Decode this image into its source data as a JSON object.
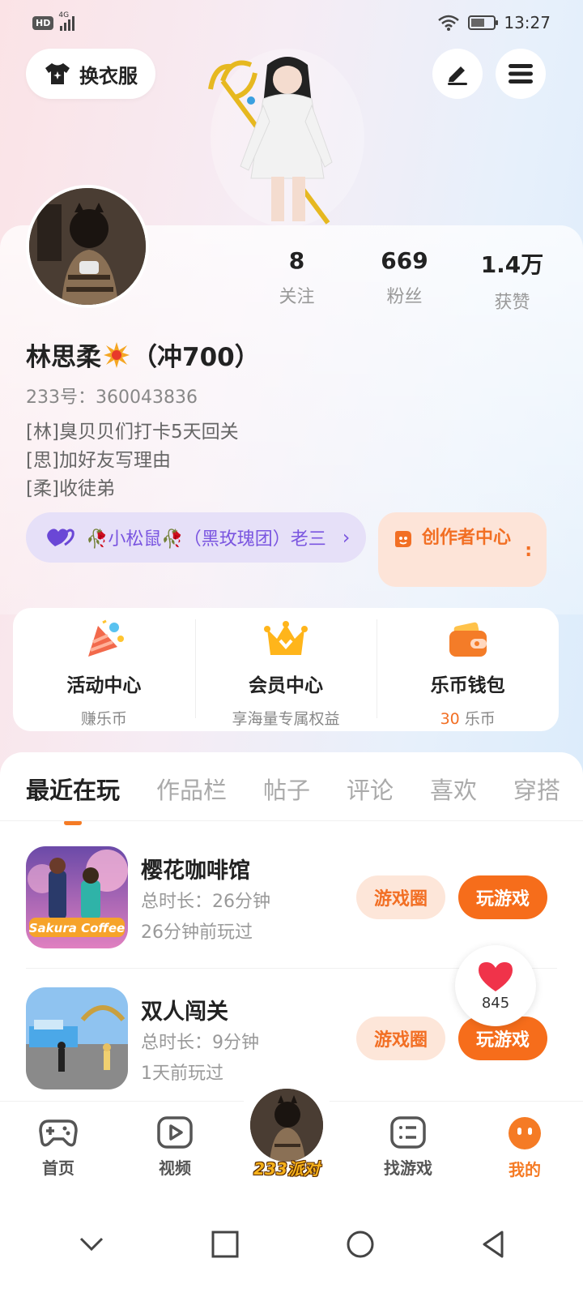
{
  "status_bar": {
    "hd": "HD",
    "network": "4G",
    "time": "13:27"
  },
  "header": {
    "outfit_label": "换衣服"
  },
  "stats": [
    {
      "value": "8",
      "label": "关注"
    },
    {
      "value": "669",
      "label": "粉丝"
    },
    {
      "value": "1.4万",
      "label": "获赞"
    }
  ],
  "profile": {
    "name": "林思柔",
    "name_suffix": "（冲700）",
    "uid": "233号：360043836",
    "bio": [
      "[林]臭贝贝们打卡5天回关",
      "[思]加好友写理由",
      "[柔]收徒弟"
    ],
    "family": "🥀小松鼠🥀（黑玫瑰团）老三",
    "creator": "创作者中心"
  },
  "quick": [
    {
      "title": "活动中心",
      "sub": "赚乐币"
    },
    {
      "title": "会员中心",
      "sub": "享海量专属权益"
    },
    {
      "title": "乐币钱包",
      "sub_value": "30",
      "sub_unit": " 乐币"
    }
  ],
  "tabs": [
    "最近在玩",
    "作品栏",
    "帖子",
    "评论",
    "喜欢",
    "穿搭"
  ],
  "games": [
    {
      "title": "樱花咖啡馆",
      "duration": "总时长：26分钟",
      "last": "26分钟前玩过",
      "logo_text": "Sakura Coffee",
      "circle": "游戏圈",
      "play": "玩游戏"
    },
    {
      "title": "双人闯关",
      "duration": "总时长：9分钟",
      "last": "1天前玩过",
      "circle": "游戏圈",
      "play": "玩游戏"
    }
  ],
  "like_count": "845",
  "bottom_nav": [
    {
      "label": "首页",
      "icon": "gamepad-icon"
    },
    {
      "label": "视频",
      "icon": "video-icon"
    },
    {
      "label": "233派对",
      "icon": "party-avatar"
    },
    {
      "label": "找游戏",
      "icon": "list-icon"
    },
    {
      "label": "我的",
      "icon": "face-icon"
    }
  ],
  "colors": {
    "accent": "#f57b25",
    "purple": "#7a55e0",
    "purple_bg": "#e6e0f8"
  }
}
